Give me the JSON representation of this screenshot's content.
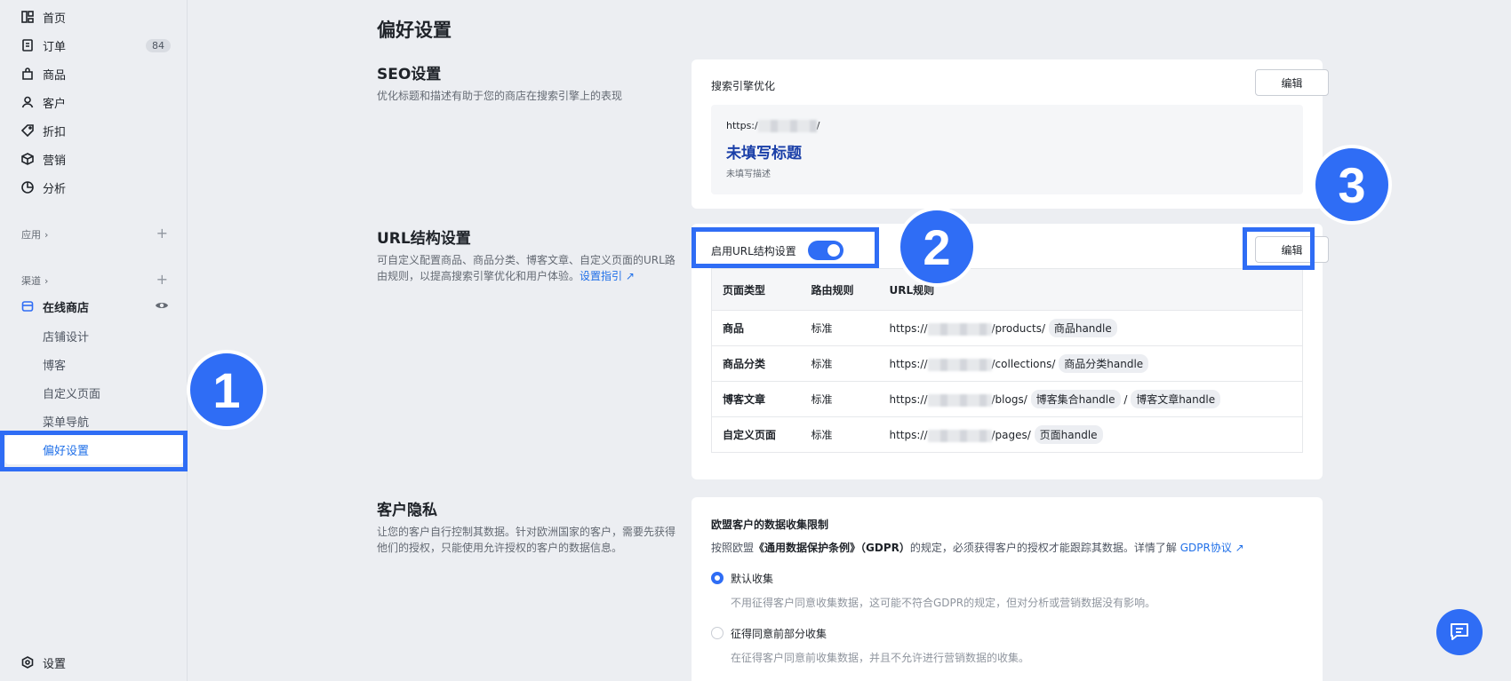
{
  "sidebar": {
    "items": [
      {
        "label": "首页",
        "icon": "dashboard-icon"
      },
      {
        "label": "订单",
        "icon": "order-icon",
        "badge": "84"
      },
      {
        "label": "商品",
        "icon": "bag-icon"
      },
      {
        "label": "客户",
        "icon": "user-icon"
      },
      {
        "label": "折扣",
        "icon": "tag-icon"
      },
      {
        "label": "营销",
        "icon": "cube-icon"
      },
      {
        "label": "分析",
        "icon": "chart-icon"
      }
    ],
    "apps_label": "应用",
    "channels_label": "渠道",
    "online_store": "在线商店",
    "sub_items": [
      "店铺设计",
      "博客",
      "自定义页面",
      "菜单导航",
      "偏好设置"
    ],
    "settings": "设置"
  },
  "page_title": "偏好设置",
  "seo": {
    "title": "SEO设置",
    "desc": "优化标题和描述有助于您的商店在搜索引擎上的表现",
    "card_label": "搜索引擎优化",
    "edit": "编辑",
    "url_prefix": "https:/",
    "url_suffix": "/",
    "preview_title": "未填写标题",
    "preview_desc": "未填写描述"
  },
  "url_settings": {
    "title": "URL结构设置",
    "desc": "可自定义配置商品、商品分类、博客文章、自定义页面的URL路由规则，以提高搜索引擎优化和用户体验。",
    "guide_link": "设置指引",
    "toggle_label": "启用URL结构设置",
    "edit": "编辑",
    "headers": [
      "页面类型",
      "路由规则",
      "URL规则"
    ],
    "rows": [
      {
        "type": "商品",
        "rule": "标准",
        "prefix": "https://",
        "path": "/products/",
        "tags": [
          "商品handle"
        ]
      },
      {
        "type": "商品分类",
        "rule": "标准",
        "prefix": "https://",
        "path": "/collections/",
        "tags": [
          "商品分类handle"
        ]
      },
      {
        "type": "博客文章",
        "rule": "标准",
        "prefix": "https://",
        "path": "/blogs/",
        "tags": [
          "博客集合handle",
          "博客文章handle"
        ],
        "sep": "/"
      },
      {
        "type": "自定义页面",
        "rule": "标准",
        "prefix": "https://",
        "path": "/pages/",
        "tags": [
          "页面handle"
        ]
      }
    ]
  },
  "privacy": {
    "title": "客户隐私",
    "desc": "让您的客户自行控制其数据。针对欧洲国家的客户，需要先获得他们的授权，只能使用允许授权的客户的数据信息。",
    "card_label": "欧盟客户的数据收集限制",
    "notice_pre": "按照欧盟",
    "notice_bold": "《通用数据保护条例》（GDPR）",
    "notice_post": "的规定，必须获得客户的授权才能跟踪其数据。详情了解",
    "gdpr_link": "GDPR协议",
    "options": [
      {
        "label": "默认收集",
        "desc": "不用征得客户同意收集数据，这可能不符合GDPR的规定，但对分析或营销数据没有影响。",
        "selected": true
      },
      {
        "label": "征得同意前部分收集",
        "desc": "在征得客户同意前收集数据，并且不允许进行营销数据的收集。",
        "selected": false
      }
    ]
  },
  "callouts": [
    "1",
    "2",
    "3"
  ],
  "accent_color": "#2f6df5"
}
